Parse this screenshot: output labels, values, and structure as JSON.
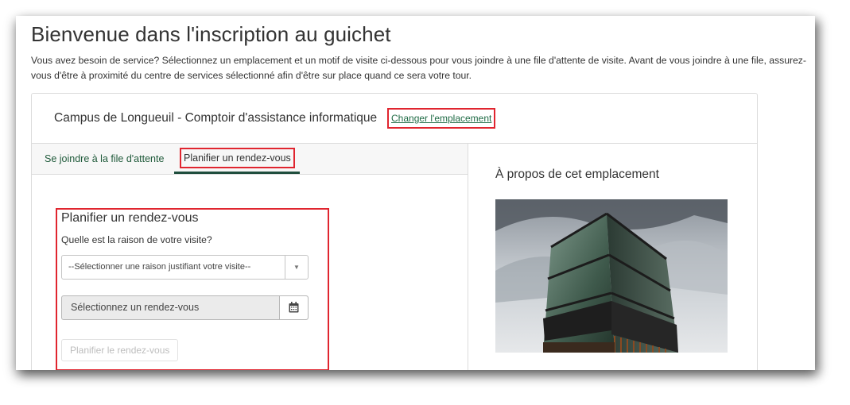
{
  "page": {
    "title": "Bienvenue dans l'inscription au guichet",
    "intro": "Vous avez besoin de service? Sélectionnez un emplacement et un motif de visite ci-dessous pour vous joindre à une file d'attente de visite. Avant de vous joindre à une file, assurez-vous d'être à proximité du centre de services sélectionné afin d'être sur place quand ce sera votre tour."
  },
  "location": {
    "name": "Campus de Longueuil - Comptoir d'assistance informatique",
    "change_link": "Changer l'emplacement"
  },
  "tabs": [
    {
      "label": "Se joindre à la file d'attente",
      "active": false
    },
    {
      "label": "Planifier un rendez-vous",
      "active": true
    }
  ],
  "plan": {
    "heading": "Planifier un rendez-vous",
    "reason_question": "Quelle est la raison de votre visite?",
    "reason_select_value": "--Sélectionner une raison justifiant votre visite--",
    "appointment_placeholder": "Sélectionnez un rendez-vous",
    "submit_label": "Planifier le rendez-vous"
  },
  "about": {
    "title": "À propos de cet emplacement"
  },
  "icons": {
    "select_arrow": "caret-down-icon",
    "calendar": "calendar-icon"
  },
  "colors": {
    "link_green": "#1f6b45",
    "active_tab_underline": "#1f4e3d",
    "highlight_red": "#e0252f"
  }
}
